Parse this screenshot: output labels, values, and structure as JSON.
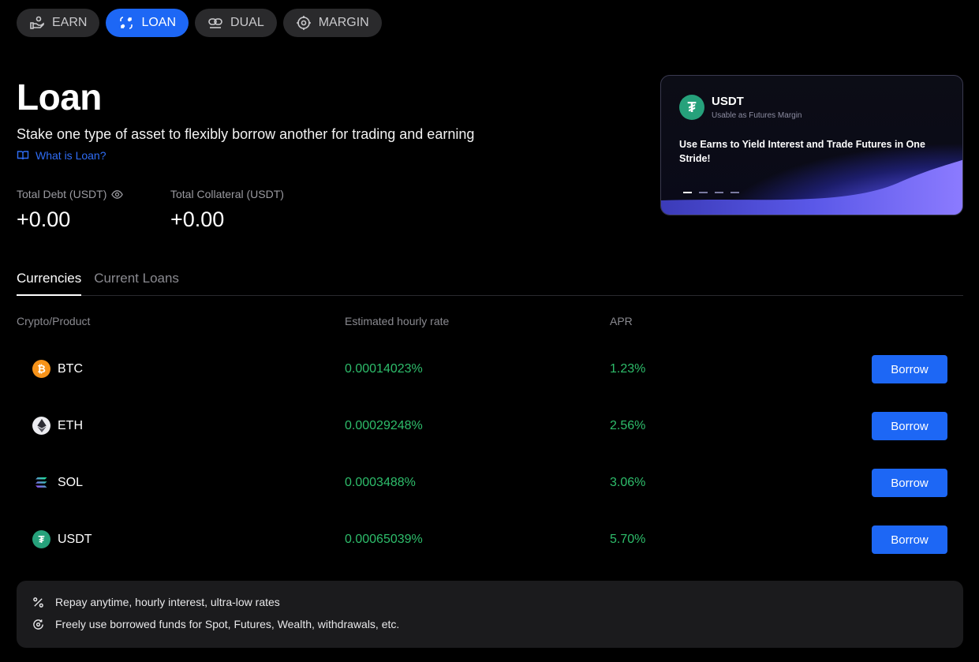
{
  "nav": {
    "items": [
      {
        "label": "EARN",
        "icon": "hand-coin-icon",
        "active": false
      },
      {
        "label": "LOAN",
        "icon": "loan-icon",
        "active": true
      },
      {
        "label": "DUAL",
        "icon": "dual-icon",
        "active": false
      },
      {
        "label": "MARGIN",
        "icon": "margin-icon",
        "active": false
      }
    ]
  },
  "page": {
    "title": "Loan",
    "subtitle": "Stake one type of asset to flexibly borrow another for trading and earning",
    "help_link": "What is Loan?"
  },
  "stats": {
    "debt_label": "Total Debt (USDT)",
    "debt_value": "+0.00",
    "collateral_label": "Total Collateral (USDT)",
    "collateral_value": "+0.00"
  },
  "banner": {
    "coin": "USDT",
    "caption": "Usable as Futures Margin",
    "message": "Use Earns to Yield Interest and Trade Futures in One Stride!"
  },
  "tabs": [
    "Currencies",
    "Current Loans"
  ],
  "table": {
    "headers": {
      "product": "Crypto/Product",
      "rate": "Estimated hourly rate",
      "apr": "APR"
    },
    "rows": [
      {
        "name": "BTC",
        "rate": "0.00014023%",
        "apr": "1.23%",
        "action": "Borrow"
      },
      {
        "name": "ETH",
        "rate": "0.00029248%",
        "apr": "2.56%",
        "action": "Borrow"
      },
      {
        "name": "SOL",
        "rate": "0.0003488%",
        "apr": "3.06%",
        "action": "Borrow"
      },
      {
        "name": "USDT",
        "rate": "0.00065039%",
        "apr": "5.70%",
        "action": "Borrow"
      }
    ]
  },
  "features": [
    "Repay anytime, hourly interest, ultra-low rates",
    "Freely use borrowed funds for Spot, Futures, Wealth, withdrawals, etc."
  ],
  "colors": {
    "accent": "#1d67f5",
    "positive": "#2ebd6b",
    "btc": "#f7931a",
    "usdt": "#26a17b"
  }
}
